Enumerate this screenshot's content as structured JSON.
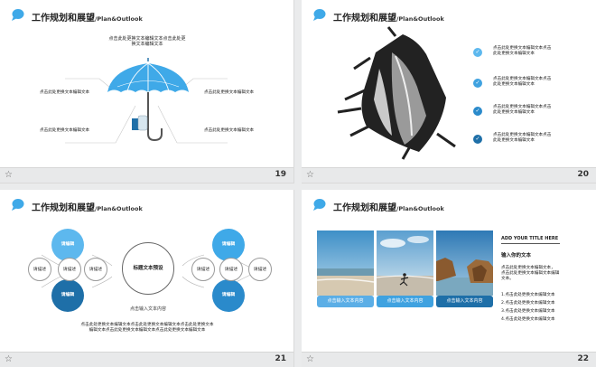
{
  "slides": [
    {
      "num": "19",
      "title": "工作规划和展望",
      "subtitle": "/Plan&Outlook",
      "top_text": [
        "点击此处更换文本编辑文本点击此处更",
        "换文本编辑文本"
      ],
      "items": [
        "点击此处更换文本编辑文本",
        "点击此处更换文本编辑文本",
        "点击此处更换文本编辑文本",
        "点击此处更换文本编辑文本"
      ]
    },
    {
      "num": "20",
      "title": "工作规划和展望",
      "subtitle": "/Plan&Outlook",
      "items": [
        [
          "点击此处更换文本编辑文本点击",
          "此处更换文本编辑文本"
        ],
        [
          "点击此处更换文本编辑文本点击",
          "此处更换文本编辑文本"
        ],
        [
          "点击此处更换文本编辑文本点击",
          "此处更换文本编辑文本"
        ],
        [
          "点击此处更换文本编辑文本点击",
          "此处更换文本编辑文本"
        ]
      ]
    },
    {
      "num": "21",
      "title": "工作规划和展望",
      "subtitle": "/Plan&Outlook",
      "center": "标题文本预设",
      "filled": [
        "请编辑",
        "请编辑",
        "请编辑",
        "请编辑"
      ],
      "small": [
        "请描述",
        "请描述",
        "请描述",
        "请描述",
        "请描述",
        "请描述"
      ],
      "below": "点击输入文本内容",
      "bottom": [
        "点击此处更换文本编辑文本点击此处更换文本编辑文本点击此处更换文本",
        "编辑文本点击此处更换文本编辑文本点击此处更换文本编辑文本"
      ]
    },
    {
      "num": "22",
      "title": "工作规划和展望",
      "subtitle": "/Plan&Outlook",
      "buttons": [
        "点击输入文本内容",
        "点击输入文本内容",
        "点击输入文本内容"
      ],
      "heading": "ADD YOUR TITLE HERE",
      "sub_heading": "输入你的文本",
      "para": [
        "点击此处更换文本编辑文本，",
        "点击此处更换文本编辑文本编辑",
        "文本。"
      ],
      "list": [
        "1.点击此处更换文本编辑文本",
        "2.点击此处更换文本编辑文本",
        "3.点击此处更换文本编辑文本",
        "4.点击此处更换文本编辑文本"
      ]
    }
  ],
  "colors": {
    "accent": "#3fa9e8",
    "dark_blue": "#1e6fa8",
    "light_blue": "#5db8ee"
  }
}
